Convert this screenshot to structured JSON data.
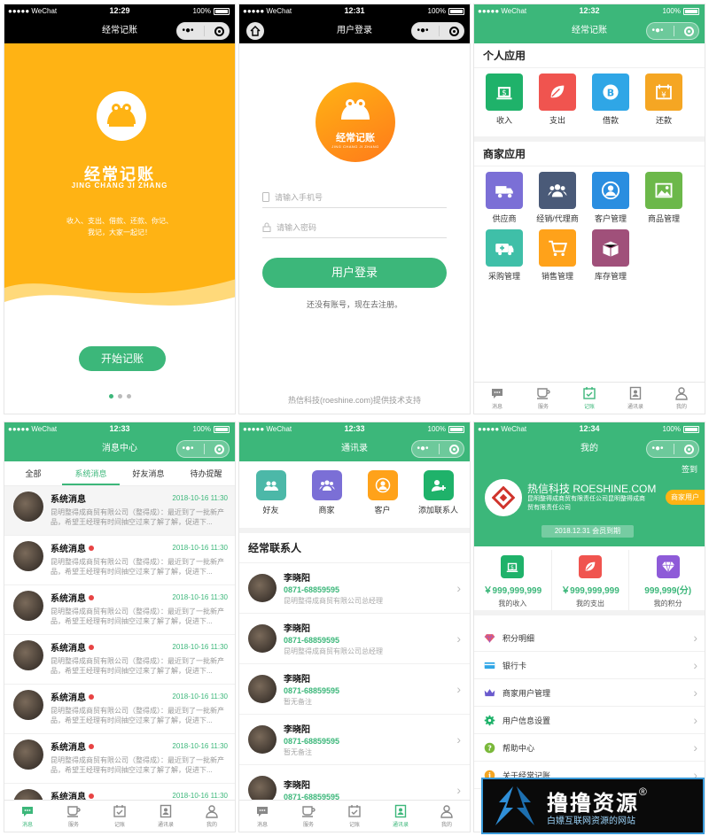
{
  "status": {
    "carrier": "●●●●● WeChat",
    "battery": "100%",
    "times": [
      "12:29",
      "12:31",
      "12:32",
      "12:33",
      "12:33",
      "12:34"
    ]
  },
  "screen1": {
    "nav_title": "经常记账",
    "brand_cn": "经常记账",
    "brand_en": "JING CHANG JI ZHANG",
    "slogan": "收入、支出、借款、还款、你记、我记，大家一起记！",
    "start_button": "开始记账"
  },
  "screen2": {
    "nav_title": "用户登录",
    "logo_cn": "经常记账",
    "logo_en": "JING CHANG JI ZHANG",
    "phone_placeholder": "请输入手机号",
    "password_placeholder": "请输入密码",
    "login_button": "用户登录",
    "register_link": "还没有账号，现在去注册。",
    "footer": "热信科技(roeshine.com)提供技术支持"
  },
  "screen3": {
    "nav_title": "经常记账",
    "personal_title": "个人应用",
    "personal_items": [
      {
        "label": "收入",
        "color": "#1fb26a",
        "icon": "money-icon"
      },
      {
        "label": "支出",
        "color": "#f0544f",
        "icon": "leaf-icon"
      },
      {
        "label": "借款",
        "color": "#2fa6e6",
        "icon": "bitcoin-icon"
      },
      {
        "label": "还款",
        "color": "#f5a623",
        "icon": "calendar-yen-icon"
      }
    ],
    "merchant_title": "商家应用",
    "merchant_items": [
      {
        "label": "供应商",
        "color": "#7b6fd6",
        "icon": "truck-icon"
      },
      {
        "label": "经销/代理商",
        "color": "#4a5a78",
        "icon": "group-icon"
      },
      {
        "label": "客户管理",
        "color": "#2a8ee0",
        "icon": "user-icon"
      },
      {
        "label": "商品管理",
        "color": "#6cb84a",
        "icon": "image-icon"
      },
      {
        "label": "采购管理",
        "color": "#3fbfa8",
        "icon": "ambulance-icon"
      },
      {
        "label": "销售管理",
        "color": "#ffa21a",
        "icon": "cart-icon"
      },
      {
        "label": "库存管理",
        "color": "#a0507a",
        "icon": "box-icon"
      }
    ]
  },
  "tabbar": {
    "items": [
      "消息",
      "服务",
      "记账",
      "通讯录",
      "我的"
    ]
  },
  "screen4": {
    "nav_title": "消息中心",
    "tabs": [
      "全部",
      "系统消息",
      "好友消息",
      "待办提醒"
    ],
    "messages": [
      {
        "title": "系统消息",
        "time": "2018-10-16 11:30",
        "text": "昆明整得成商贸有限公司（整得成）：最近到了一批新产品，希望王经理有时间抽空过来了解了解，促进下...",
        "unread": false
      },
      {
        "title": "系统消息",
        "time": "2018-10-16 11:30",
        "text": "昆明整得成商贸有限公司（整得成）：最近到了一批新产品，希望王经理有时间抽空过来了解了解，促进下...",
        "unread": true
      },
      {
        "title": "系统消息",
        "time": "2018-10-16 11:30",
        "text": "昆明整得成商贸有限公司（整得成）：最近到了一批新产品，希望王经理有时间抽空过来了解了解，促进下...",
        "unread": true
      },
      {
        "title": "系统消息",
        "time": "2018-10-16 11:30",
        "text": "昆明整得成商贸有限公司（整得成）：最近到了一批新产品，希望王经理有时间抽空过来了解了解，促进下...",
        "unread": true
      },
      {
        "title": "系统消息",
        "time": "2018-10-16 11:30",
        "text": "昆明整得成商贸有限公司（整得成）：最近到了一批新产品，希望王经理有时间抽空过来了解了解，促进下...",
        "unread": true
      },
      {
        "title": "系统消息",
        "time": "2018-10-16 11:30",
        "text": "昆明整得成商贸有限公司（整得成）：最近到了一批新产品，希望王经理有时间抽空过来了解了解，促进下...",
        "unread": true
      },
      {
        "title": "系统消息",
        "time": "2018-10-16 11:30",
        "text": "",
        "unread": true
      }
    ]
  },
  "screen5": {
    "nav_title": "通讯录",
    "quick": [
      {
        "label": "好友",
        "color": "#4cb8a8",
        "icon": "friends-icon"
      },
      {
        "label": "商家",
        "color": "#7b6fd6",
        "icon": "group-icon"
      },
      {
        "label": "客户",
        "color": "#ffa21a",
        "icon": "user-icon"
      },
      {
        "label": "添加联系人",
        "color": "#1fb26a",
        "icon": "add-user-icon"
      }
    ],
    "frequent_title": "经常联系人",
    "contacts": [
      {
        "name": "李晓阳",
        "phone": "0871-68859595",
        "sub": "昆明整得成商贸有限公司总经理"
      },
      {
        "name": "李晓阳",
        "phone": "0871-68859595",
        "sub": "昆明整得成商贸有限公司总经理"
      },
      {
        "name": "李晓阳",
        "phone": "0871-68859595",
        "sub": "暂无备注"
      },
      {
        "name": "李晓阳",
        "phone": "0871-68859595",
        "sub": "暂无备注"
      },
      {
        "name": "李晓阳",
        "phone": "0871-68859595",
        "sub": ""
      }
    ]
  },
  "screen6": {
    "nav_title": "我的",
    "sign_in": "签到",
    "company_en": "热信科技 ROESHINE.COM",
    "company_cn": "昆明整得成商贸有限责任公司昆明整得成商贸有限责任公司",
    "merchant_badge": "商家用户",
    "expiry": "2018.12.31 会员到期",
    "stats": [
      {
        "value": "￥999,999,999",
        "label": "我的收入",
        "color": "#1fb26a",
        "icon": "money-icon"
      },
      {
        "value": "￥999,999,999",
        "label": "我的支出",
        "color": "#f0544f",
        "icon": "leaf-icon"
      },
      {
        "value": "999,999(分)",
        "label": "我的积分",
        "color": "#8e5bd8",
        "icon": "diamond-icon"
      }
    ],
    "menu": [
      {
        "label": "积分明细",
        "icon": "diamond-icon",
        "color": "#e85a6a"
      },
      {
        "label": "银行卡",
        "icon": "card-icon",
        "color": "#2fa6e6"
      },
      {
        "label": "商家用户管理",
        "icon": "crown-icon",
        "color": "#6a5acd"
      },
      {
        "label": "用户信息设置",
        "icon": "gear-icon",
        "color": "#1fb26a"
      },
      {
        "label": "帮助中心",
        "icon": "help-icon",
        "color": "#7ab83a"
      },
      {
        "label": "关于经常记账",
        "icon": "info-icon",
        "color": "#f5a623"
      }
    ]
  },
  "watermark": {
    "title": "撸撸资源",
    "registered": "®",
    "subtitle": "白嫖互联网资源的网站"
  }
}
